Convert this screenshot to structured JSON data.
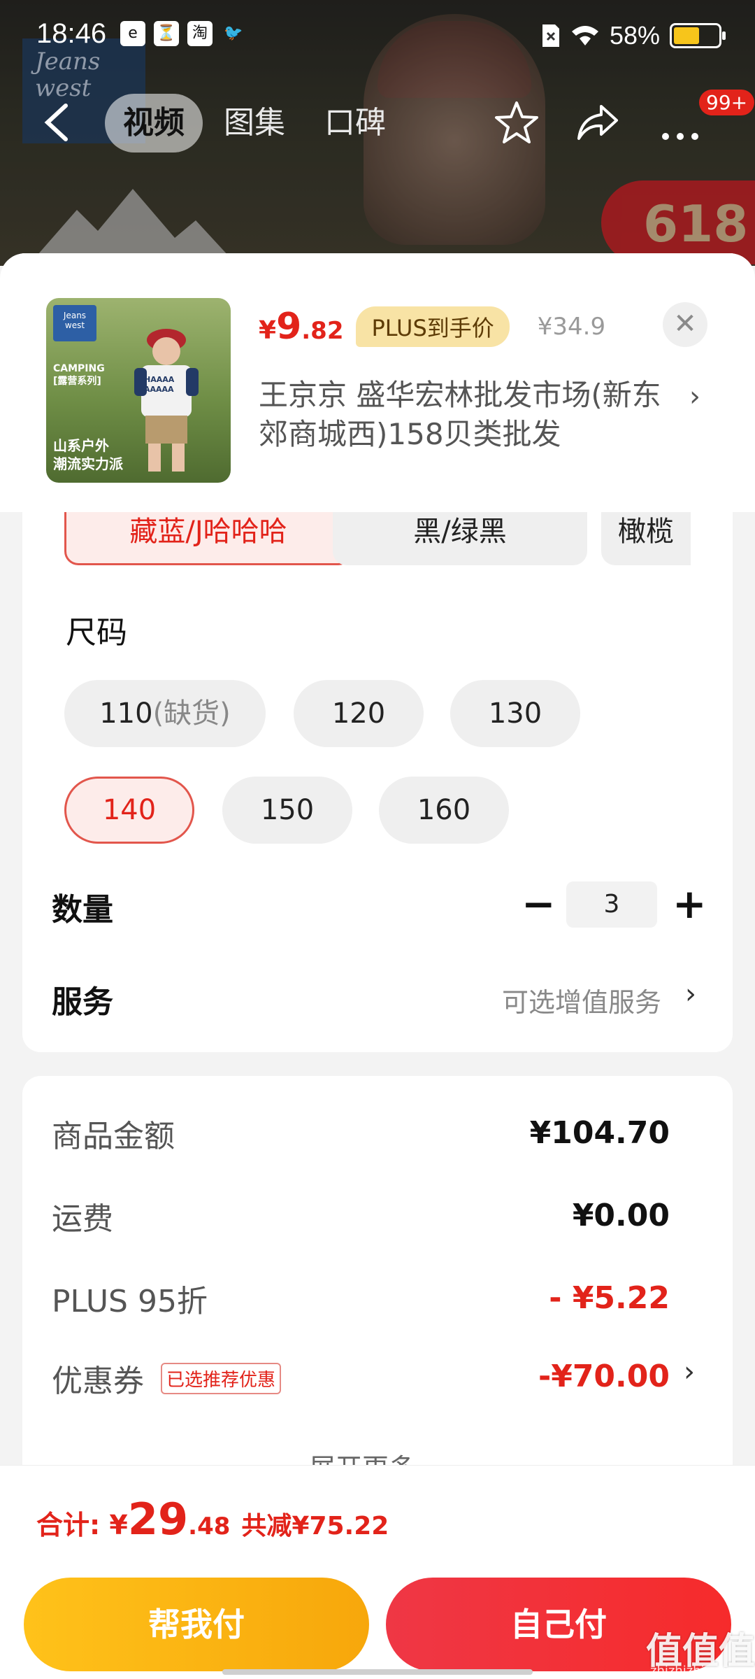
{
  "status_bar": {
    "time": "18:46",
    "battery": "58%",
    "battery_level": 0.58,
    "app_icons": [
      "e",
      "⏳",
      "淘",
      "🐦"
    ]
  },
  "hero": {
    "brand": "Jeans west",
    "badge": "618"
  },
  "nav": {
    "tabs": [
      {
        "label": "视频",
        "active": true
      },
      {
        "label": "图集",
        "active": false
      },
      {
        "label": "口碑",
        "active": false
      }
    ],
    "badge": "99+"
  },
  "product": {
    "thumb": {
      "logo": "Jeans west",
      "camping": "CAMPING\n[露营系列]",
      "tagline": "山系户外\n潮流实力派",
      "shirt_text": "HAAAA AAAAA"
    },
    "price_symbol": "¥",
    "price_int": "9",
    "price_dec": ".82",
    "plus_label": "PLUS到手价",
    "original_price": "¥34.9",
    "shop": "王京京  盛华宏林批发市场(新东郊商城西)158贝类批发"
  },
  "colors": {
    "options": [
      "藏蓝/J哈哈哈",
      "黑/绿黑",
      "橄榄"
    ],
    "selected_index": 0
  },
  "size": {
    "label": "尺码",
    "options": [
      {
        "value": "110",
        "note": "(缺货)"
      },
      {
        "value": "120",
        "note": ""
      },
      {
        "value": "130",
        "note": ""
      },
      {
        "value": "140",
        "note": ""
      },
      {
        "value": "150",
        "note": ""
      },
      {
        "value": "160",
        "note": ""
      }
    ],
    "selected": "140"
  },
  "quantity": {
    "label": "数量",
    "value": "3",
    "minus": "−",
    "plus": "+"
  },
  "service": {
    "label": "服务",
    "value": "可选增值服务"
  },
  "summary": {
    "items": [
      {
        "label": "商品金额",
        "value": "¥104.70",
        "red": false
      },
      {
        "label": "运费",
        "value": "¥0.00",
        "red": false
      },
      {
        "label": "PLUS 95折",
        "value": "- ¥5.22",
        "red": true
      },
      {
        "label": "优惠券",
        "value": "-¥70.00",
        "red": true,
        "tag": "已选推荐优惠"
      }
    ],
    "expand": "展开更多 ⌄"
  },
  "footer": {
    "total_label": "合计: ¥",
    "total_int": "29",
    "total_dec": ".48",
    "saved": "共减¥75.22",
    "helper_pay": "帮我付",
    "self_pay": "自己付"
  },
  "watermark": {
    "main": "值值值",
    "sub": "zhizhizhi.com"
  },
  "accent": {
    "red": "#e2231a",
    "yellow": "#f7a70b",
    "plus_gold": "#f8e3a5"
  }
}
